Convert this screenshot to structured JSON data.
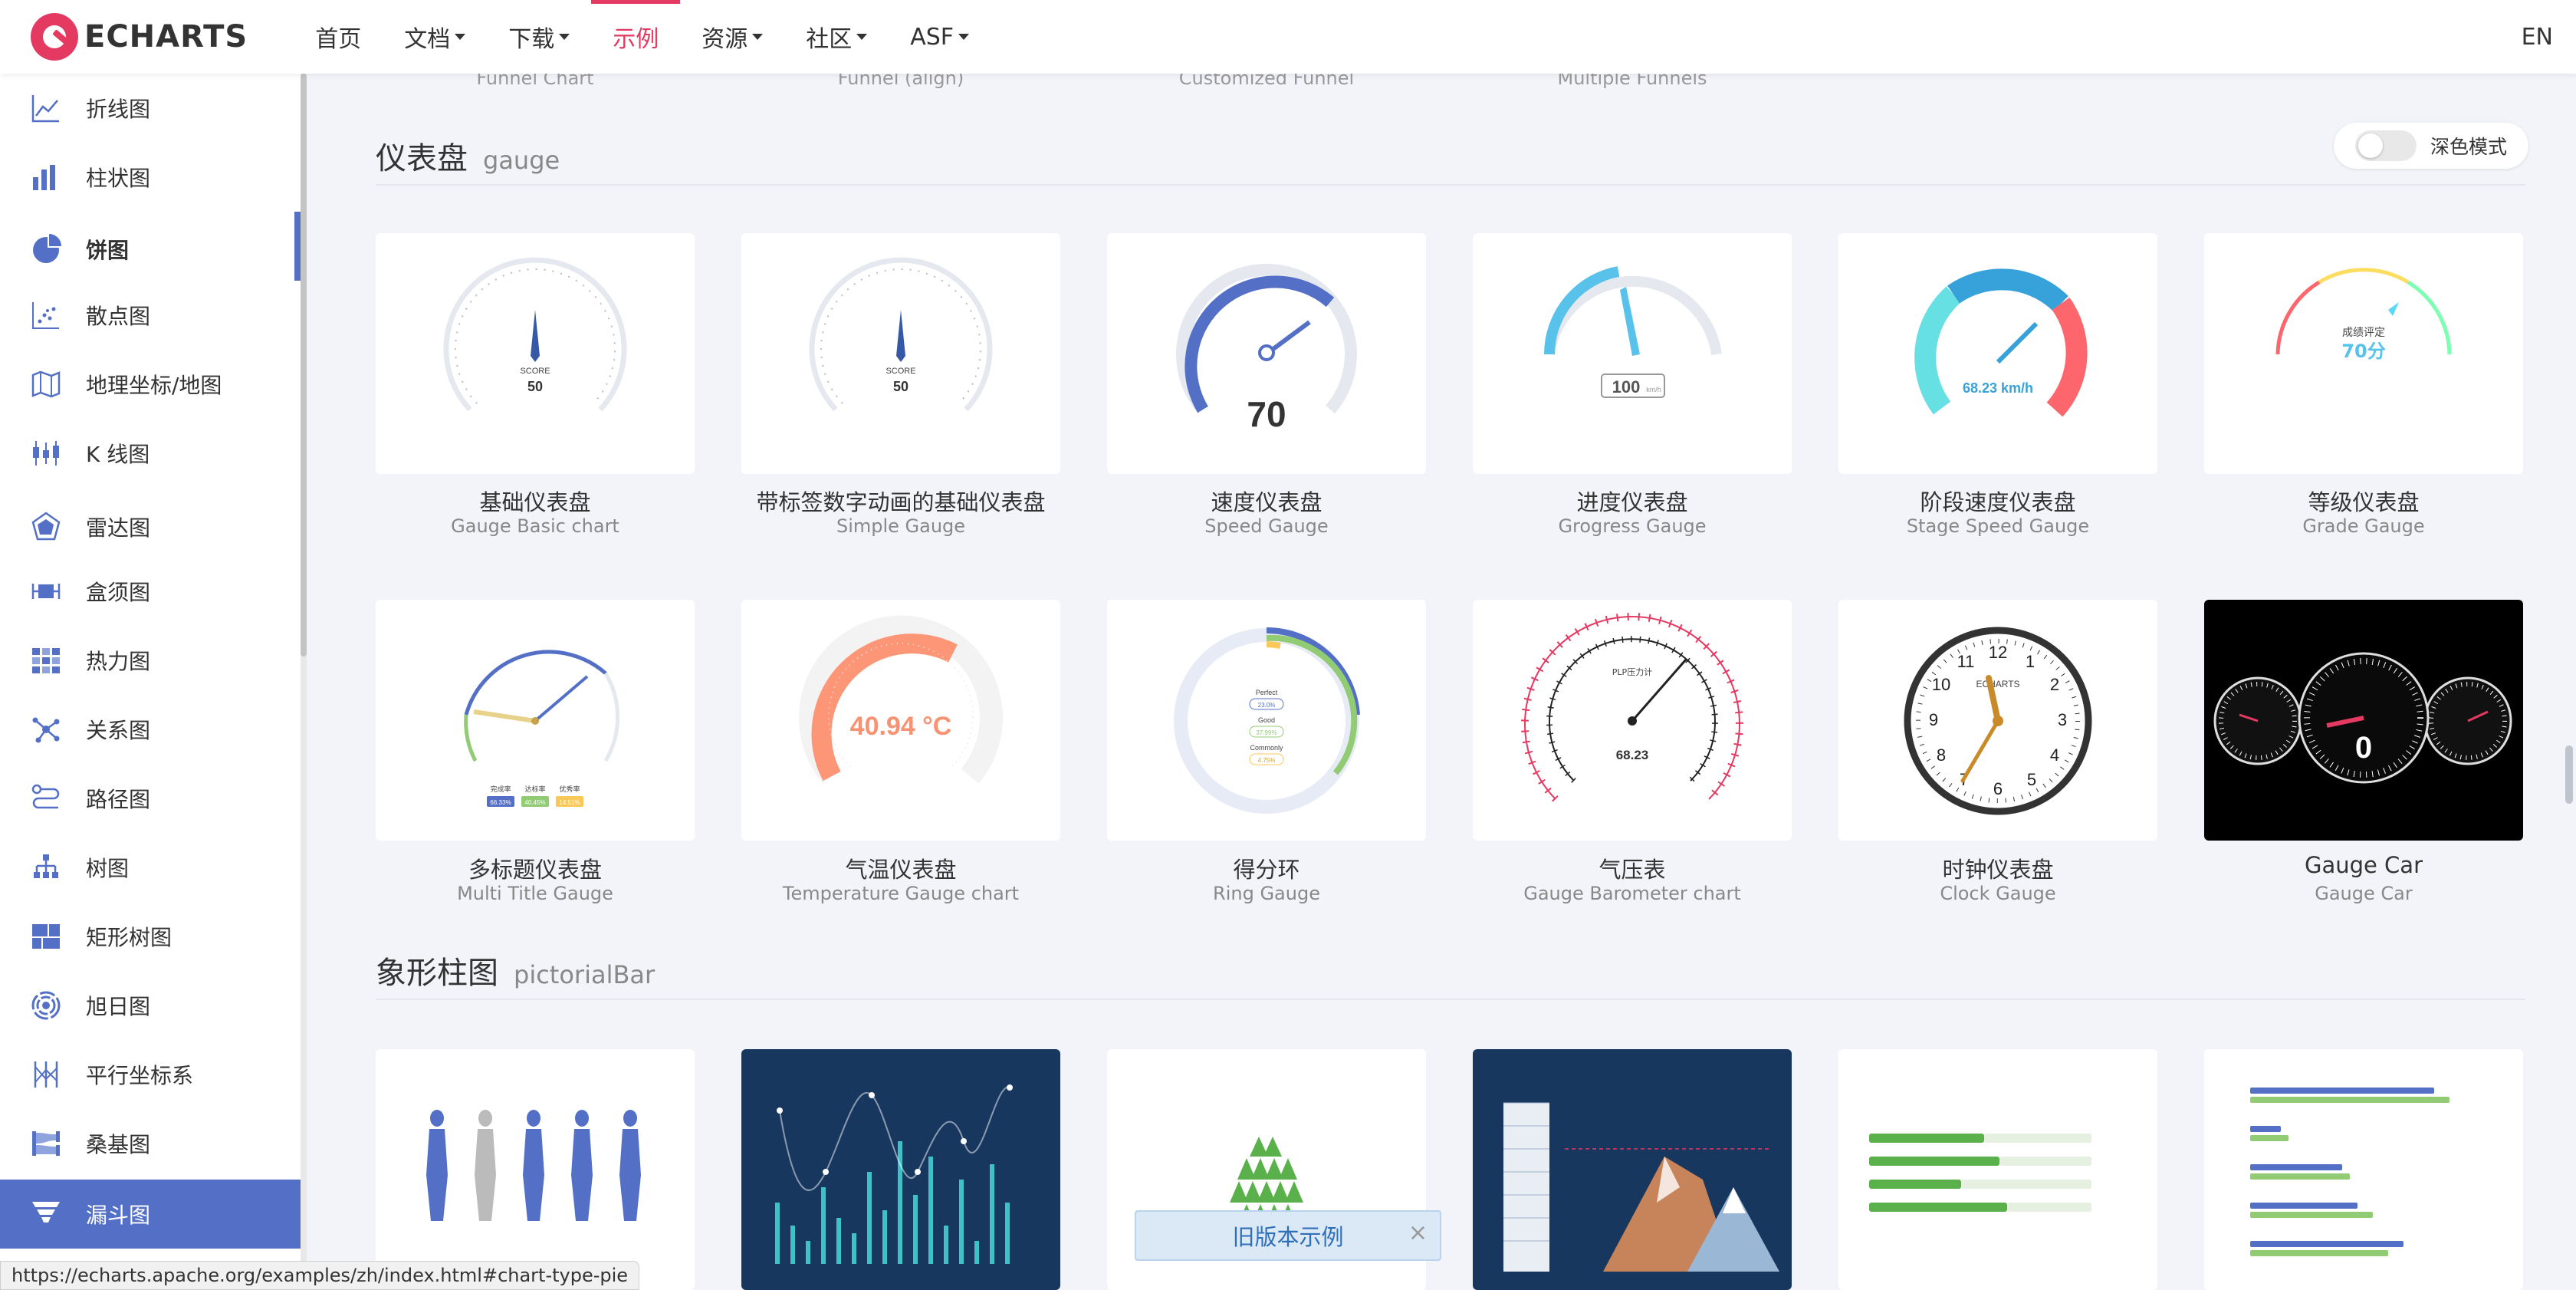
{
  "nav": {
    "logo_text": "ECHARTS",
    "items": [
      {
        "label": "首页",
        "dropdown": false
      },
      {
        "label": "文档",
        "dropdown": true
      },
      {
        "label": "下载",
        "dropdown": true
      },
      {
        "label": "示例",
        "dropdown": false,
        "active": true
      },
      {
        "label": "资源",
        "dropdown": true
      },
      {
        "label": "社区",
        "dropdown": true
      },
      {
        "label": "ASF",
        "dropdown": true
      }
    ],
    "lang": "EN",
    "accent_color": "#e43961"
  },
  "sidebar": {
    "items": [
      {
        "label": "折线图",
        "icon": "line-chart-icon"
      },
      {
        "label": "柱状图",
        "icon": "bar-chart-icon"
      },
      {
        "label": "饼图",
        "icon": "pie-chart-icon",
        "current": true
      },
      {
        "label": "散点图",
        "icon": "scatter-icon"
      },
      {
        "label": "地理坐标/地图",
        "icon": "map-icon"
      },
      {
        "label": "K 线图",
        "icon": "candlestick-icon"
      },
      {
        "label": "雷达图",
        "icon": "radar-icon"
      },
      {
        "label": "盒须图",
        "icon": "boxplot-icon"
      },
      {
        "label": "热力图",
        "icon": "heatmap-icon"
      },
      {
        "label": "关系图",
        "icon": "graph-icon"
      },
      {
        "label": "路径图",
        "icon": "lines-icon"
      },
      {
        "label": "树图",
        "icon": "tree-icon"
      },
      {
        "label": "矩形树图",
        "icon": "treemap-icon"
      },
      {
        "label": "旭日图",
        "icon": "sunburst-icon"
      },
      {
        "label": "平行坐标系",
        "icon": "parallel-icon"
      },
      {
        "label": "桑基图",
        "icon": "sankey-icon"
      },
      {
        "label": "漏斗图",
        "icon": "funnel-icon",
        "active": true
      }
    ],
    "active_color": "#5470c6"
  },
  "prev_section_labels": [
    "Funnel Chart",
    "Funnel (align)",
    "Customized Funnel",
    "Multiple Funnels"
  ],
  "gauge_section": {
    "title": "仪表盘",
    "title_en": "gauge",
    "dark_mode_label": "深色模式",
    "cards": [
      {
        "title": "基础仪表盘",
        "subtitle": "Gauge Basic chart",
        "thumb": {
          "label": "SCORE",
          "value": "50"
        }
      },
      {
        "title": "带标签数字动画的基础仪表盘",
        "subtitle": "Simple Gauge",
        "thumb": {
          "label": "SCORE",
          "value": "50"
        }
      },
      {
        "title": "速度仪表盘",
        "subtitle": "Speed Gauge",
        "thumb": {
          "value": "70"
        }
      },
      {
        "title": "进度仪表盘",
        "subtitle": "Grogress Gauge",
        "thumb": {
          "value": "100",
          "unit": "km/h"
        }
      },
      {
        "title": "阶段速度仪表盘",
        "subtitle": "Stage Speed Gauge",
        "thumb": {
          "value": "68.23 km/h"
        }
      },
      {
        "title": "等级仪表盘",
        "subtitle": "Grade Gauge",
        "thumb": {
          "label": "成绩评定",
          "value": "70分"
        }
      },
      {
        "title": "多标题仪表盘",
        "subtitle": "Multi Title Gauge",
        "thumb": {
          "labels": [
            "完成率",
            "达标率",
            "优秀率"
          ],
          "values": [
            "66.33%",
            "40.45%",
            "14.51%"
          ]
        }
      },
      {
        "title": "气温仪表盘",
        "subtitle": "Temperature Gauge chart",
        "thumb": {
          "value": "40.94 °C"
        }
      },
      {
        "title": "得分环",
        "subtitle": "Ring Gauge",
        "thumb": {
          "labels": [
            "Perfect",
            "Good",
            "Commonly"
          ],
          "values": [
            "23.0%",
            "37.99%",
            "4.75%"
          ]
        }
      },
      {
        "title": "气压表",
        "subtitle": "Gauge Barometer chart",
        "thumb": {
          "label": "PLP压力计",
          "value": "68.23"
        }
      },
      {
        "title": "时钟仪表盘",
        "subtitle": "Clock Gauge",
        "thumb": {
          "label": "ECHARTS"
        }
      },
      {
        "title": "Gauge Car",
        "subtitle": "Gauge Car",
        "thumb": {
          "value": "0"
        }
      }
    ]
  },
  "pictorial_section": {
    "title": "象形柱图",
    "title_en": "pictorialBar"
  },
  "old_example_banner": {
    "label": "旧版本示例",
    "close": "×"
  },
  "status_url": "https://echarts.apache.org/examples/zh/index.html#chart-type-pie"
}
